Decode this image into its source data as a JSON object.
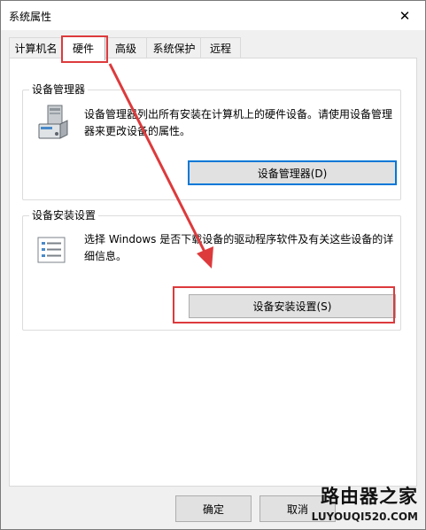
{
  "window": {
    "title": "系统属性",
    "close_glyph": "✕"
  },
  "tabs": [
    {
      "label": "计算机名",
      "active": false
    },
    {
      "label": "硬件",
      "active": true
    },
    {
      "label": "高级",
      "active": false
    },
    {
      "label": "系统保护",
      "active": false
    },
    {
      "label": "远程",
      "active": false
    }
  ],
  "device_manager": {
    "group_title": "设备管理器",
    "description": "设备管理器列出所有安装在计算机上的硬件设备。请使用设备管理器来更改设备的属性。",
    "button_label": "设备管理器(D)",
    "icon": "device-manager-icon"
  },
  "device_install": {
    "group_title": "设备安装设置",
    "description": "选择 Windows 是否下载设备的驱动程序软件及有关这些设备的详细信息。",
    "button_label": "设备安装设置(S)",
    "icon": "settings-list-icon"
  },
  "footer": {
    "ok_label": "确定",
    "cancel_label": "取消"
  },
  "watermark": {
    "site_name": "路由器之家",
    "url": "LUYOUQI520.COM"
  },
  "colors": {
    "annotation": "#dd3a3c",
    "focus_border": "#0078d7",
    "window_bg": "#f0f0f0"
  }
}
